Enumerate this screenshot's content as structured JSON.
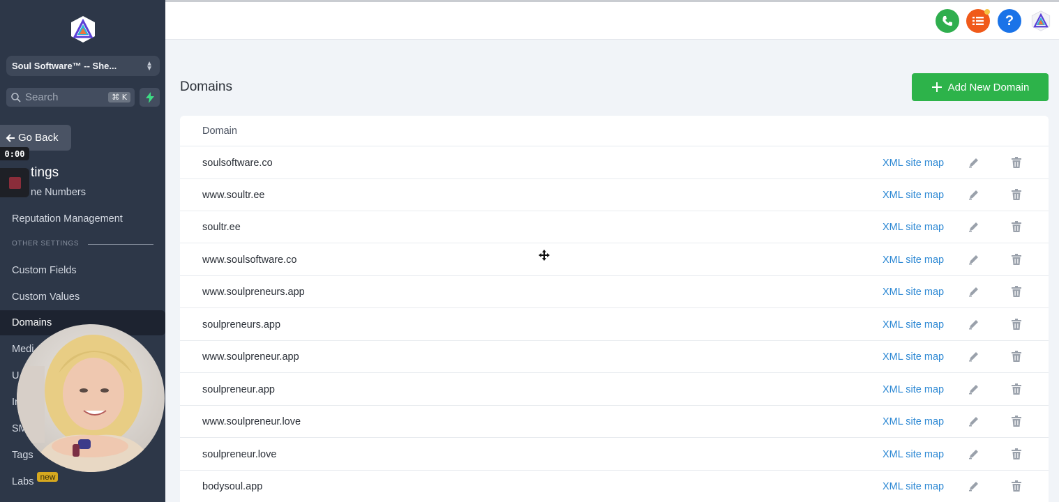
{
  "sidebar": {
    "account_name": "Soul Software™ -- She...",
    "search_placeholder": "Search",
    "search_shortcut": "⌘ K",
    "go_back_label": "Go Back",
    "settings_title_fragment": "tings",
    "phone_numbers_fragment": "ne Numbers",
    "reputation_label": "Reputation Management",
    "section_other_settings": "OTHER SETTINGS",
    "custom_fields_label": "Custom Fields",
    "custom_values_label": "Custom Values",
    "domains_label": "Domains",
    "media_fragment": "Medi",
    "u_fragment": "U",
    "i_fragment": "In",
    "sm_fragment": "SM",
    "tags_label": "Tags",
    "labs_label": "Labs",
    "labs_badge": "new"
  },
  "recorder": {
    "timer": "0:00"
  },
  "topbar": {
    "icons": [
      "phone-icon",
      "task-list-icon",
      "help-icon",
      "app-logo-icon"
    ],
    "colors": {
      "phone": "#2fae4e",
      "tasks": "#f05a1a",
      "help": "#1a73e8"
    }
  },
  "main": {
    "title": "Domains",
    "add_button_label": "Add New Domain",
    "table_header": "Domain",
    "row_link_label": "XML site map",
    "rows": [
      "soulsoftware.co",
      "www.soultr.ee",
      "soultr.ee",
      "www.soulsoftware.co",
      "www.soulpreneurs.app",
      "soulpreneurs.app",
      "www.soulpreneur.app",
      "soulpreneur.app",
      "www.soulpreneur.love",
      "soulpreneur.love",
      "bodysoul.app"
    ]
  },
  "colors": {
    "sidebar_bg": "#2d3748",
    "accent_green": "#2db34a",
    "link_blue": "#2b87d3"
  }
}
